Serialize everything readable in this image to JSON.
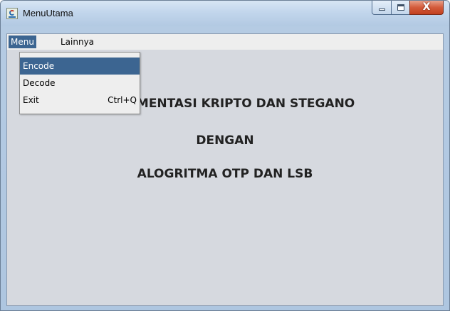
{
  "window": {
    "title": "MenuUtama",
    "close_glyph": "X"
  },
  "menubar": {
    "items": [
      {
        "label": "Menu"
      },
      {
        "label": "Lainnya"
      }
    ]
  },
  "dropdown": {
    "items": [
      {
        "label": "Encode",
        "accelerator": ""
      },
      {
        "label": "Decode",
        "accelerator": ""
      },
      {
        "label": "Exit",
        "accelerator": "Ctrl+Q"
      }
    ]
  },
  "content": {
    "line1": "IMPLEMENTASI KRIPTO DAN STEGANO",
    "line2": "DENGAN",
    "line3": "ALOGRITMA OTP DAN LSB"
  },
  "colors": {
    "selection": "#3c6591",
    "client_background": "#d6d9df",
    "title_bar": "#c2d6ec",
    "close_button": "#c2401f"
  },
  "icons": {
    "app": "java-cup-icon",
    "minimize": "minimize-icon",
    "maximize": "maximize-icon",
    "close": "close-icon"
  }
}
